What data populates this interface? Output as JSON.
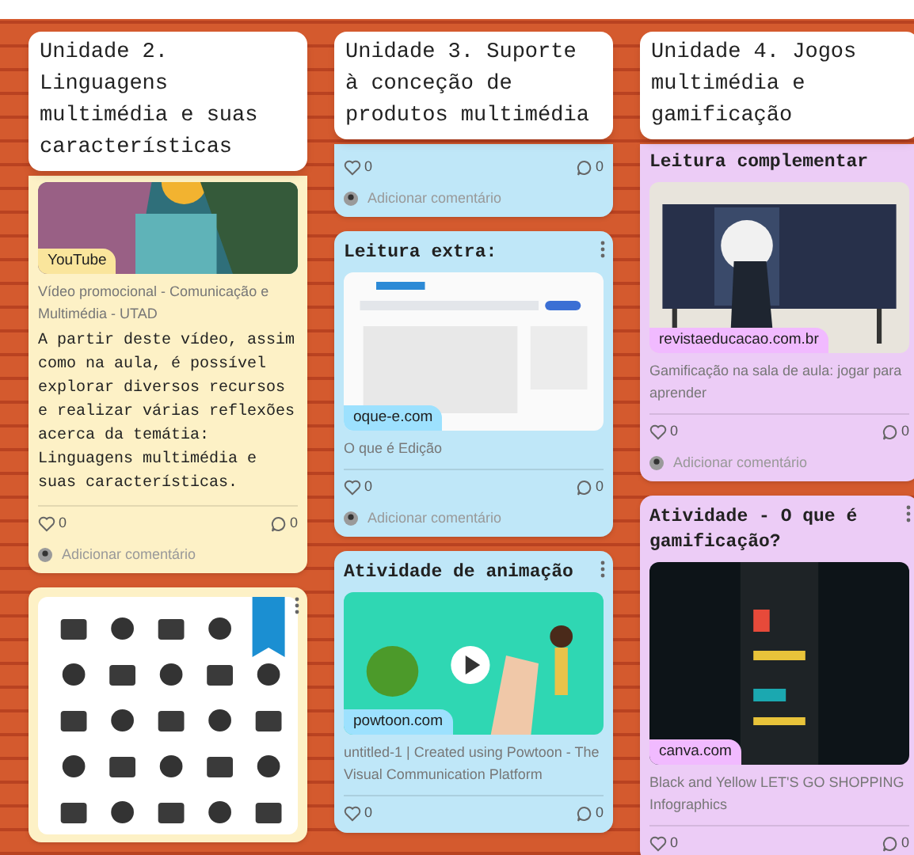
{
  "columns": [
    {
      "title": "Unidade 2. Linguagens multimédia e suas características",
      "color": "#fdf1c6",
      "posts": [
        {
          "attachment": {
            "kind": "video",
            "source": "YouTube"
          },
          "link_title": "Vídeo promocional - Comunicação e Multimédia - UTAD",
          "body": "A partir deste vídeo, assim como na aula, é possível explorar diversos recursos e realizar várias reflexões acerca da temátia: Linguagens multimédia e suas características.",
          "likes": "0",
          "comments": "0",
          "add_comment": "Adicionar comentário"
        },
        {
          "menu": true,
          "attachment": {
            "kind": "icons"
          }
        }
      ]
    },
    {
      "title": "Unidade 3. Suporte à conceção de produtos multimédia",
      "color": "#bfe7f8",
      "posts": [
        {
          "likes": "0",
          "comments": "0",
          "add_comment": "Adicionar comentário"
        },
        {
          "menu": true,
          "title": "Leitura extra:",
          "attachment": {
            "kind": "webpage",
            "source": "oque-e.com"
          },
          "link_title": "O que é Edição",
          "likes": "0",
          "comments": "0",
          "add_comment": "Adicionar comentário"
        },
        {
          "menu": true,
          "title": "Atividade de animação",
          "attachment": {
            "kind": "animation",
            "source": "powtoon.com"
          },
          "link_title": "untitled-1 | Created using Powtoon - The Visual Communication Platform",
          "likes": "0",
          "comments": "0"
        }
      ]
    },
    {
      "title": "Unidade 4. Jogos multimédia e gamificação",
      "color": "#ecccf6",
      "posts": [
        {
          "title": "Leitura complementar",
          "attachment": {
            "source": "revistaeducacao.com.br"
          },
          "link_title": "Gamificação na sala de aula: jogar para aprender",
          "likes": "0",
          "comments": "0",
          "add_comment": "Adicionar comentário"
        },
        {
          "menu": true,
          "title": "Atividade - O que é gamificação?",
          "attachment": {
            "kind": "infographic",
            "source": "canva.com"
          },
          "link_title": "Black and Yellow LET'S GO SHOPPING Infographics",
          "likes": "0",
          "comments": "0"
        }
      ]
    }
  ]
}
